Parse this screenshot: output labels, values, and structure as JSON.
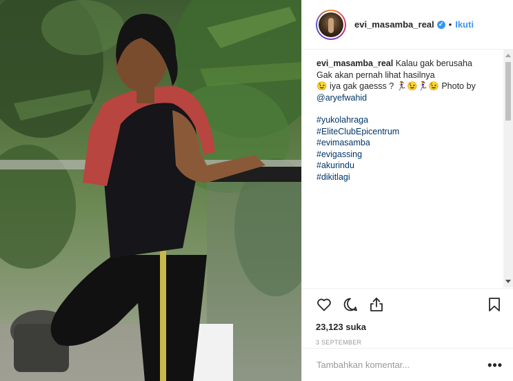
{
  "post": {
    "username": "evi_masamba_real",
    "verified_icon": "verified-check-icon",
    "separator": "•",
    "follow_label": "Ikuti",
    "caption": {
      "username": "evi_masamba_real",
      "line1": "Kalau gak berusaha",
      "line2": "Gak akan pernah lihat hasilnya",
      "line3": "😉 iya gak gaesss ? 🏃‍♀️😉🏃‍♀️😉 Photo by",
      "mention": "@aryefwahid",
      "hashtags": [
        "#yukolahraga",
        "#EliteClubEpicentrum",
        "#evimasamba",
        "#evigassing",
        "#akurindu",
        "#dikitlagi"
      ]
    },
    "likes": "23,123 suka",
    "date": "3 SEPTEMBER",
    "comment_placeholder": "Tambahkan komentar...",
    "more_label": "•••"
  },
  "icons": {
    "like": "heart-icon",
    "comment": "comment-icon",
    "share": "share-icon",
    "save": "bookmark-icon"
  },
  "colors": {
    "accent": "#3897f0",
    "link": "#003569",
    "text": "#262626",
    "muted": "#999999"
  }
}
